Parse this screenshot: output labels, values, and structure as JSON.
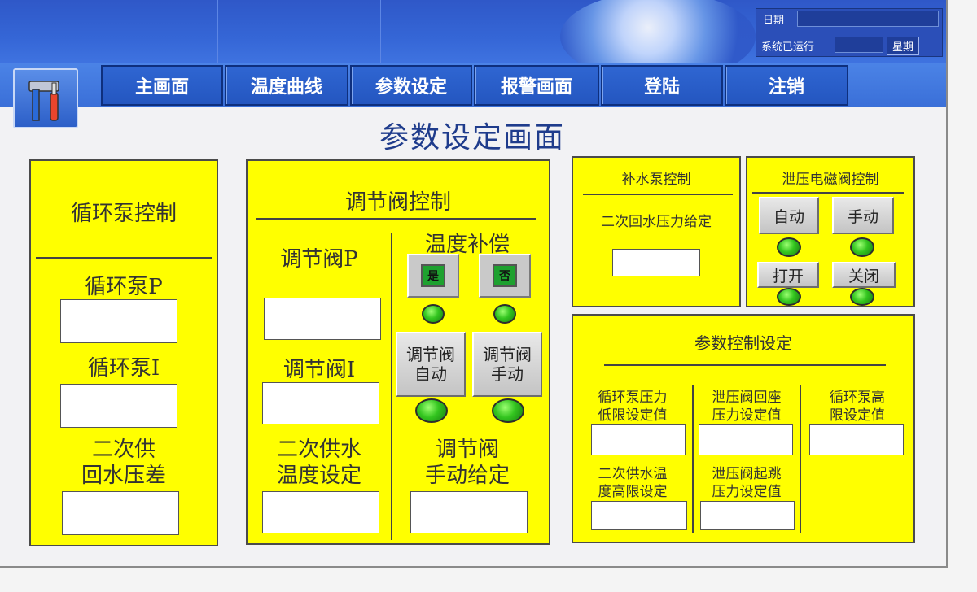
{
  "header": {
    "date_label": "日期",
    "runtime_label": "系统已运行",
    "week_label": "星期"
  },
  "nav": {
    "items": [
      "主画面",
      "温度曲线",
      "参数设定",
      "报警画面",
      "登陆",
      "注销"
    ]
  },
  "page_title": "参数设定画面",
  "circulation_pump": {
    "title": "循环泵控制",
    "p_label": "循环泵P",
    "p_value": "",
    "i_label": "循环泵I",
    "i_value": "",
    "diff_label_line1": "二次供",
    "diff_label_line2": "回水压差",
    "diff_value": ""
  },
  "regulating_valve": {
    "title": "调节阀控制",
    "p_label": "调节阀P",
    "p_value": "",
    "i_label": "调节阀I",
    "i_value": "",
    "temp_label_line1": "二次供水",
    "temp_label_line2": "温度设定",
    "temp_value": "",
    "comp_label": "温度补偿",
    "comp_yes": "是",
    "comp_no": "否",
    "auto_btn_line1": "调节阀",
    "auto_btn_line2": "自动",
    "manual_btn_line1": "调节阀",
    "manual_btn_line2": "手动",
    "manual_set_line1": "调节阀",
    "manual_set_line2": "手动给定",
    "manual_set_value": ""
  },
  "makeup_pump": {
    "title": "补水泵控制",
    "pressure_label": "二次回水压力给定",
    "pressure_value": ""
  },
  "relief_valve": {
    "title": "泄压电磁阀控制",
    "auto": "自动",
    "manual": "手动",
    "open": "打开",
    "close": "关闭"
  },
  "param_settings": {
    "title": "参数控制设定",
    "pump_low_line1": "循环泵压力",
    "pump_low_line2": "低限设定值",
    "pump_low_value": "",
    "relief_return_line1": "泄压阀回座",
    "relief_return_line2": "压力设定值",
    "relief_return_value": "",
    "pump_high_line1": "循环泵高",
    "pump_high_line2": "限设定值",
    "pump_high_value": "",
    "supply_temp_high_line1": "二次供水温",
    "supply_temp_high_line2": "度高限设定",
    "supply_temp_high_value": "",
    "relief_jump_line1": "泄压阀起跳",
    "relief_jump_line2": "压力设定值",
    "relief_jump_value": ""
  },
  "colors": {
    "panel": "#ffff00",
    "nav": "#2f66d2",
    "indicator": "#33c51f",
    "title": "#1f3c8c"
  }
}
